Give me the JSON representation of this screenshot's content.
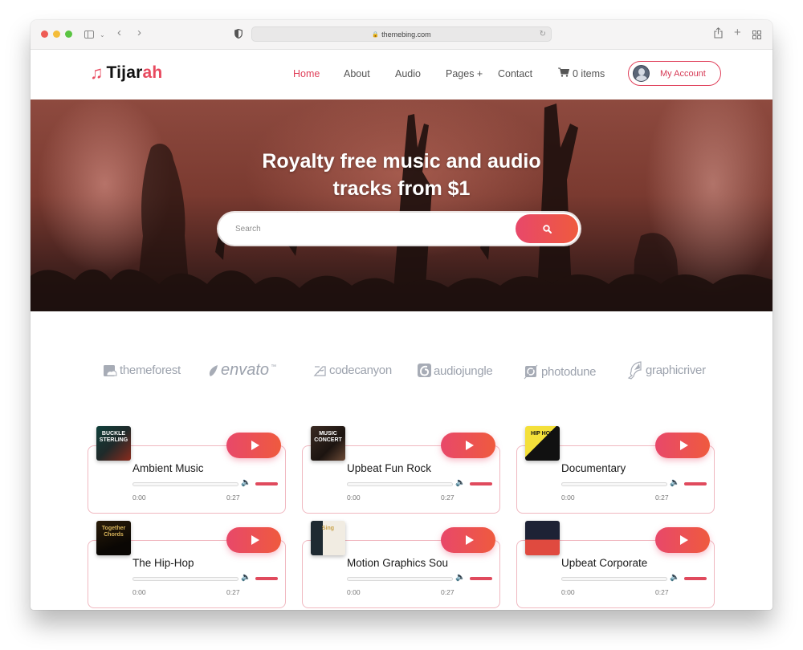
{
  "browser": {
    "url": "themebing.com"
  },
  "brand": {
    "name_main": "Tijar",
    "name_accent": "ah",
    "accent_color": "#e84a5f"
  },
  "nav": {
    "items": [
      {
        "label": "Home",
        "active": true
      },
      {
        "label": "About",
        "active": false
      },
      {
        "label": "Audio",
        "active": false
      },
      {
        "label": "Pages +",
        "active": false
      },
      {
        "label": "Contact",
        "active": false
      }
    ],
    "cart_label": "0 items",
    "account_label": "My Account"
  },
  "hero": {
    "title_line1": "Royalty free music and audio",
    "title_line2": "tracks from $1",
    "search_placeholder": "Search"
  },
  "partners": [
    {
      "name": "themeforest",
      "icon": "themeforest-icon"
    },
    {
      "name": "envato",
      "icon": "envato-leaf-icon"
    },
    {
      "name": "codecanyon",
      "icon": "codecanyon-icon"
    },
    {
      "name": "audiojungle",
      "icon": "audiojungle-icon"
    },
    {
      "name": "photodune",
      "icon": "photodune-icon"
    },
    {
      "name": "graphicriver",
      "icon": "graphicriver-icon"
    }
  ],
  "tracks": [
    {
      "title": "Ambient Music",
      "current": "0:00",
      "duration": "0:27",
      "cover_text": "BUCKLE STERLING"
    },
    {
      "title": "Upbeat Fun Rock",
      "current": "0:00",
      "duration": "0:27",
      "cover_text": "MUSIC CONCERT"
    },
    {
      "title": "Documentary",
      "current": "0:00",
      "duration": "0:27",
      "cover_text": "HIP HOP"
    },
    {
      "title": "The Hip-Hop",
      "current": "0:00",
      "duration": "0:27",
      "cover_text": "Together Chords"
    },
    {
      "title": "Motion Graphics Sou",
      "current": "0:00",
      "duration": "0:27",
      "cover_text": "Sing"
    },
    {
      "title": "Upbeat Corporate",
      "current": "0:00",
      "duration": "0:27",
      "cover_text": ""
    }
  ]
}
